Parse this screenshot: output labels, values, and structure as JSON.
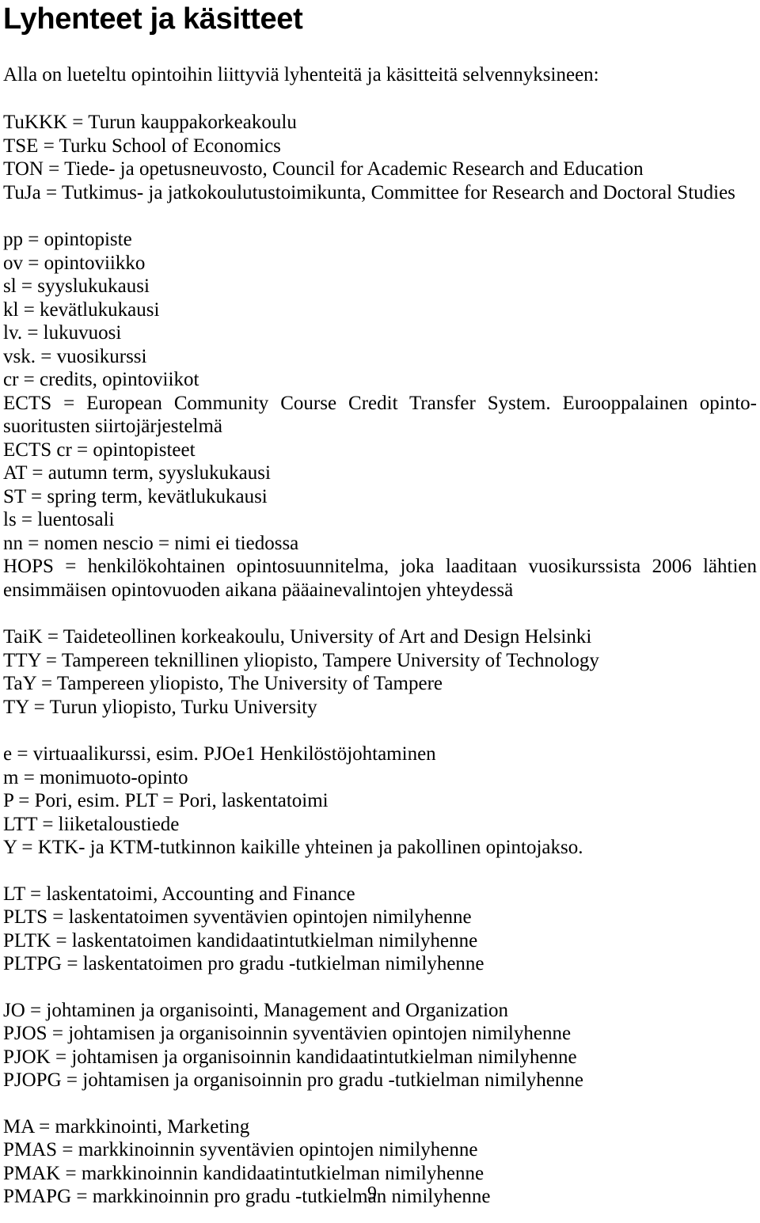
{
  "document": {
    "title": "Lyhenteet ja käsitteet",
    "intro": "Alla on lueteltu opintoihin liittyviä lyhenteitä ja käsitteitä selvennyksineen:",
    "page_number": "9"
  },
  "blocks": [
    {
      "id": "institutions-abbrev",
      "lines": [
        "TuKKK = Turun kauppakorkeakoulu",
        "TSE = Turku School of Economics",
        "TON = Tiede- ja opetusneuvosto, Council for Academic Research and Education",
        "TuJa = Tutkimus- ja jatkokoulutustoimikunta, Committee for Research and Doctoral Studies"
      ]
    },
    {
      "id": "study-units",
      "lines": [
        "pp = opintopiste",
        "ov = opintoviikko",
        "sl = syyslukukausi",
        "kl = kevätlukukausi",
        "lv. = lukuvuosi",
        "vsk. = vuosikurssi",
        "cr = credits, opintoviikot"
      ]
    },
    {
      "id": "ects-paragraph",
      "justified_lines": [
        "ECTS = European Community Course Credit Transfer System. Eurooppalainen opinto-",
        "suoritusten siirtojärjestelmä"
      ]
    },
    {
      "id": "terms-and-codes",
      "lines": [
        "ECTS cr = opintopisteet",
        "AT = autumn term, syyslukukausi",
        "ST = spring term, kevätlukukausi",
        "ls = luentosali",
        "nn = nomen nescio = nimi ei tiedossa"
      ]
    },
    {
      "id": "hops-paragraph",
      "justified_lines": [
        "HOPS = henkilökohtainen opintosuunnitelma, joka laaditaan vuosikurssista 2006 lähtien",
        "ensimmäisen opintovuoden aikana pääainevalintojen yhteydessä"
      ]
    },
    {
      "id": "universities",
      "lines": [
        "TaiK = Taideteollinen korkeakoulu, University of Art and Design Helsinki",
        "TTY = Tampereen teknillinen yliopisto, Tampere University of Technology",
        "TaY = Tampereen yliopisto, The University of Tampere",
        "TY = Turun yliopisto, Turku University"
      ]
    },
    {
      "id": "course-markers",
      "lines": [
        "e = virtuaalikurssi, esim. PJOe1 Henkilöstöjohtaminen",
        "m = monimuoto-opinto",
        "P = Pori, esim. PLT = Pori, laskentatoimi",
        "LTT = liiketaloustiede",
        "Y = KTK- ja KTM-tutkinnon kaikille yhteinen ja pakollinen opintojakso."
      ]
    },
    {
      "id": "accounting-codes",
      "lines": [
        "LT = laskentatoimi, Accounting and Finance",
        "PLTS = laskentatoimen syventävien opintojen nimilyhenne",
        "PLTK = laskentatoimen kandidaatintutkielman nimilyhenne",
        "PLTPG = laskentatoimen pro gradu -tutkielman nimilyhenne"
      ]
    },
    {
      "id": "management-codes",
      "lines": [
        "JO = johtaminen ja organisointi, Management and Organization",
        "PJOS = johtamisen ja organisoinnin syventävien opintojen nimilyhenne",
        "PJOK = johtamisen ja organisoinnin kandidaatintutkielman nimilyhenne",
        "PJOPG = johtamisen ja organisoinnin pro gradu -tutkielman nimilyhenne"
      ]
    },
    {
      "id": "marketing-codes",
      "lines": [
        "MA = markkinointi, Marketing",
        "PMAS = markkinoinnin syventävien opintojen nimilyhenne",
        "PMAK = markkinoinnin kandidaatintutkielman nimilyhenne",
        "PMAPG = markkinoinnin pro gradu -tutkielman nimilyhenne"
      ]
    }
  ]
}
